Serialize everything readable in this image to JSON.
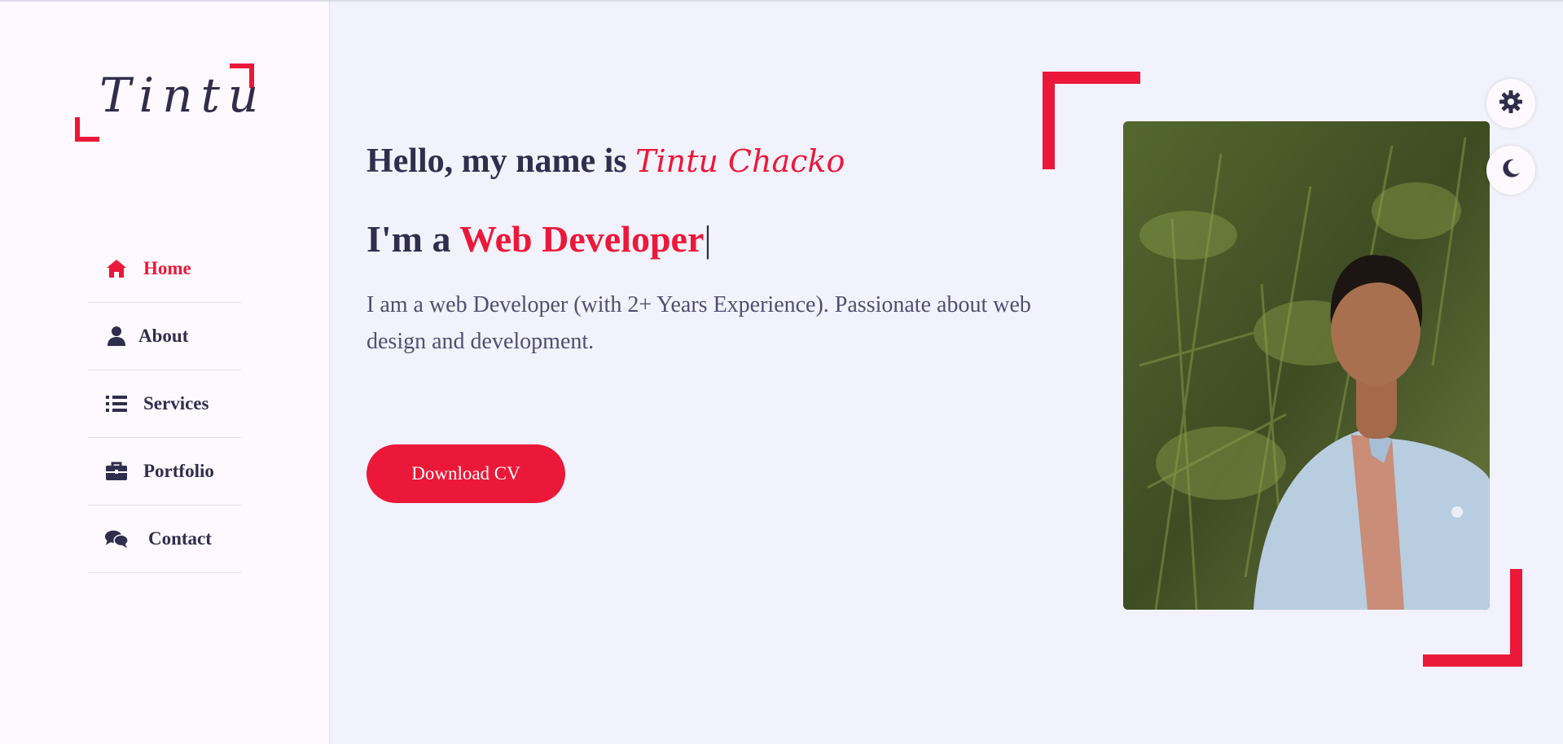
{
  "sidebar": {
    "logo": "Tintu",
    "items": [
      {
        "label": "Home",
        "icon": "home-icon",
        "active": true
      },
      {
        "label": "About",
        "icon": "user-icon",
        "active": false
      },
      {
        "label": "Services",
        "icon": "list-icon",
        "active": false
      },
      {
        "label": "Portfolio",
        "icon": "briefcase-icon",
        "active": false
      },
      {
        "label": "Contact",
        "icon": "chat-icon",
        "active": false
      }
    ]
  },
  "hero": {
    "greeting": "Hello, my name is ",
    "name": "Tintu Chacko",
    "role_prefix": "I'm a ",
    "role": "Web Developer",
    "cursor": "|",
    "description": "I am a web Developer (with 2+ Years Experience). Passionate about web design and development.",
    "cta_label": "Download CV"
  },
  "colors": {
    "accent": "#ec1839",
    "text_dark": "#302e4d",
    "background": "#f2f2fc",
    "sidebar_bg": "#fdf9ff"
  }
}
